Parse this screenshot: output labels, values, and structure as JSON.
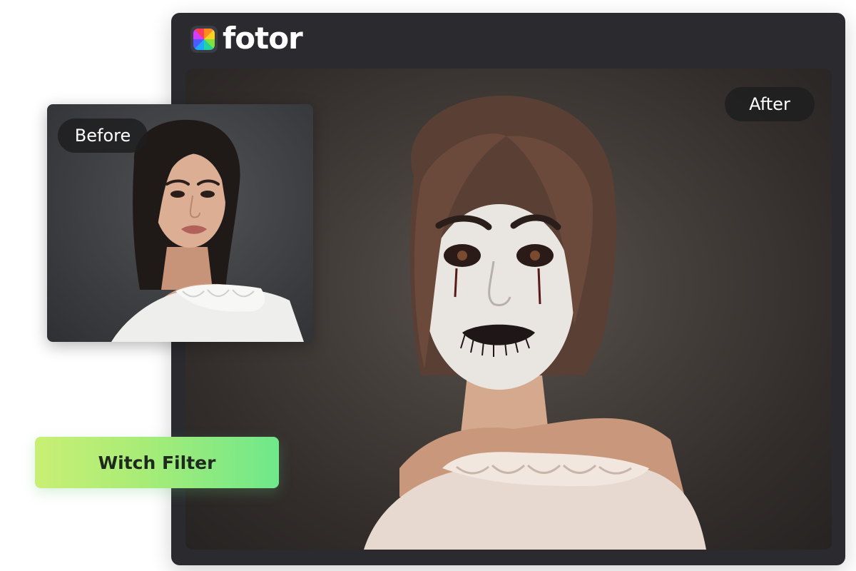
{
  "app": {
    "brand": "fotor",
    "logo_icon": "fotor-logo-icon"
  },
  "after": {
    "label": "After"
  },
  "before": {
    "label": "Before"
  },
  "filter": {
    "label": "Witch Filter",
    "colors": [
      "#c9ef74",
      "#6fe88a"
    ]
  }
}
